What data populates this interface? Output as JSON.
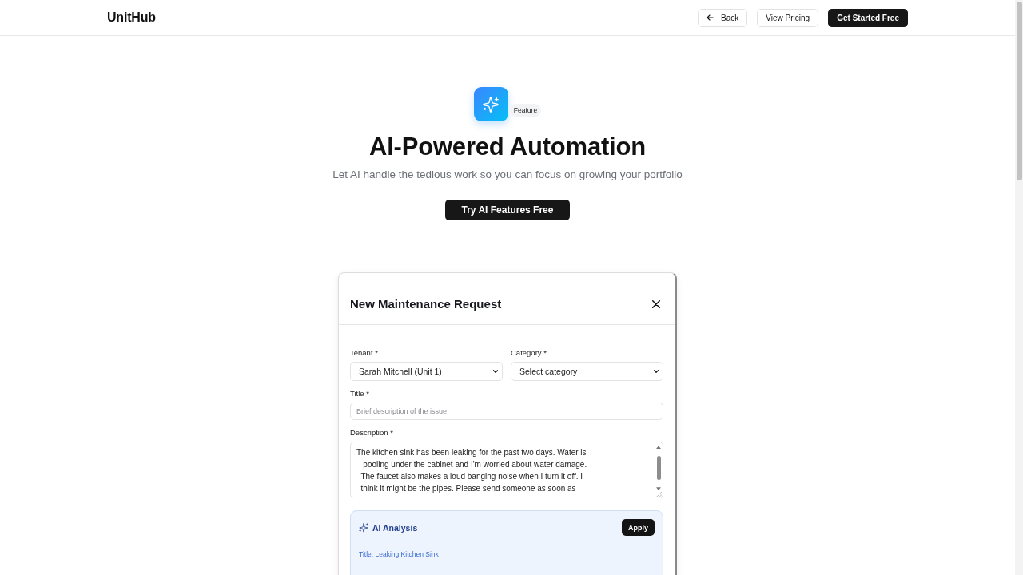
{
  "header": {
    "logo": "UnitHub",
    "buttons": [
      {
        "label": "Back",
        "kind": "back"
      },
      {
        "label": "View Pricing",
        "kind": "secondary"
      },
      {
        "label": "Get Started Free",
        "kind": "primary"
      }
    ]
  },
  "hero": {
    "badge": "Feature",
    "title": "AI-Powered Automation",
    "subtitle": "Let AI handle the tedious work so you can focus on growing your portfolio",
    "cta": "Try AI Features Free"
  },
  "modal": {
    "title": "New Maintenance Request",
    "rows": [
      [
        {
          "kind": "select",
          "label": "Tenant *",
          "value": "Sarah Mitchell (Unit 1)"
        },
        {
          "kind": "select",
          "label": "Category *",
          "value": "Select category"
        }
      ],
      [
        {
          "kind": "text",
          "label": "Title *",
          "placeholder": "Brief description of the issue"
        }
      ],
      [
        {
          "kind": "textarea",
          "label": "Description *",
          "value": "The kitchen sink has been leaking for the past two days. Water is\n   pooling under the cabinet and I'm worried about water damage.\n  The faucet also makes a loud banging noise when I turn it off. I\n  think it might be the pipes. Please send someone as soon as"
        }
      ]
    ],
    "ai_analysis": {
      "title": "AI Analysis",
      "button": "Apply",
      "items": [
        "Title: Leaking Kitchen Sink"
      ]
    }
  }
}
